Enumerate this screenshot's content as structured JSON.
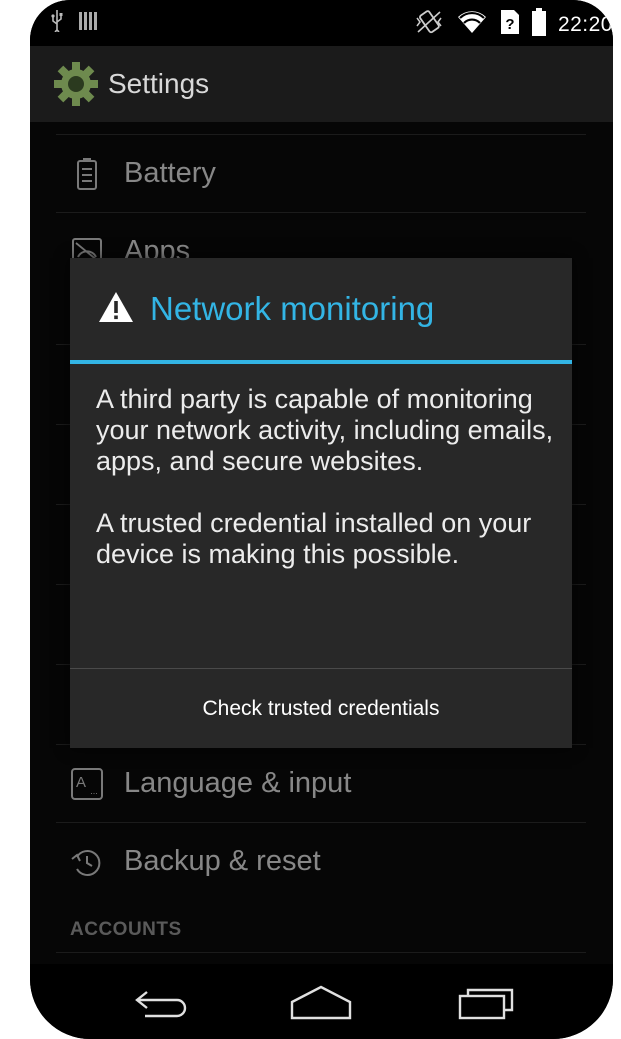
{
  "status_bar": {
    "time": "22:20",
    "icons": [
      "usb-icon",
      "storage-icon",
      "vibrate-icon",
      "wifi-icon",
      "no-sim-icon",
      "battery-icon"
    ]
  },
  "action_bar": {
    "title": "Settings",
    "icon": "settings-gear-icon"
  },
  "settings_list": {
    "items": [
      {
        "label": "Battery",
        "icon": "battery-icon"
      },
      {
        "label": "Apps",
        "icon": "apps-icon"
      },
      {
        "label": "Language & input",
        "icon": "keyboard-icon"
      },
      {
        "label": "Backup & reset",
        "icon": "backup-icon"
      }
    ],
    "section_header": "ACCOUNTS"
  },
  "dialog": {
    "title": "Network monitoring",
    "icon": "warning-icon",
    "message_1": "A third party is capable of monitoring your network activity, including emails, apps, and secure websites.",
    "message_2": "A trusted credential installed on your device is making this possible.",
    "button": "Check trusted credentials"
  },
  "nav_bar": {
    "buttons": [
      "back-icon",
      "home-icon",
      "recents-icon"
    ]
  },
  "colors": {
    "accent": "#33b5e5",
    "dialog_bg": "#282828",
    "list_bg": "#0a0a0a"
  }
}
